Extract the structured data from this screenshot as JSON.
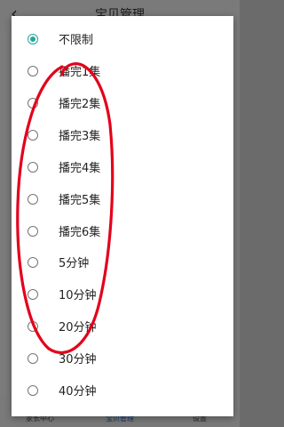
{
  "header": {
    "back_icon": "chevron-left-icon",
    "title": "宝贝管理"
  },
  "options": [
    {
      "label": "不限制",
      "checked": true
    },
    {
      "label": "播完1集",
      "checked": false
    },
    {
      "label": "播完2集",
      "checked": false
    },
    {
      "label": "播完3集",
      "checked": false
    },
    {
      "label": "播完4集",
      "checked": false
    },
    {
      "label": "播完5集",
      "checked": false
    },
    {
      "label": "播完6集",
      "checked": false
    },
    {
      "label": "5分钟",
      "checked": false
    },
    {
      "label": "10分钟",
      "checked": false
    },
    {
      "label": "20分钟",
      "checked": false
    },
    {
      "label": "30分钟",
      "checked": false
    },
    {
      "label": "40分钟",
      "checked": false
    }
  ],
  "tabbar": {
    "tabs": [
      {
        "label": "家长中心",
        "active": false
      },
      {
        "label": "宝贝管理",
        "active": true
      },
      {
        "label": "设置",
        "active": false
      }
    ]
  },
  "colors": {
    "accent": "#26a69a",
    "annotation": "#e3001b"
  }
}
